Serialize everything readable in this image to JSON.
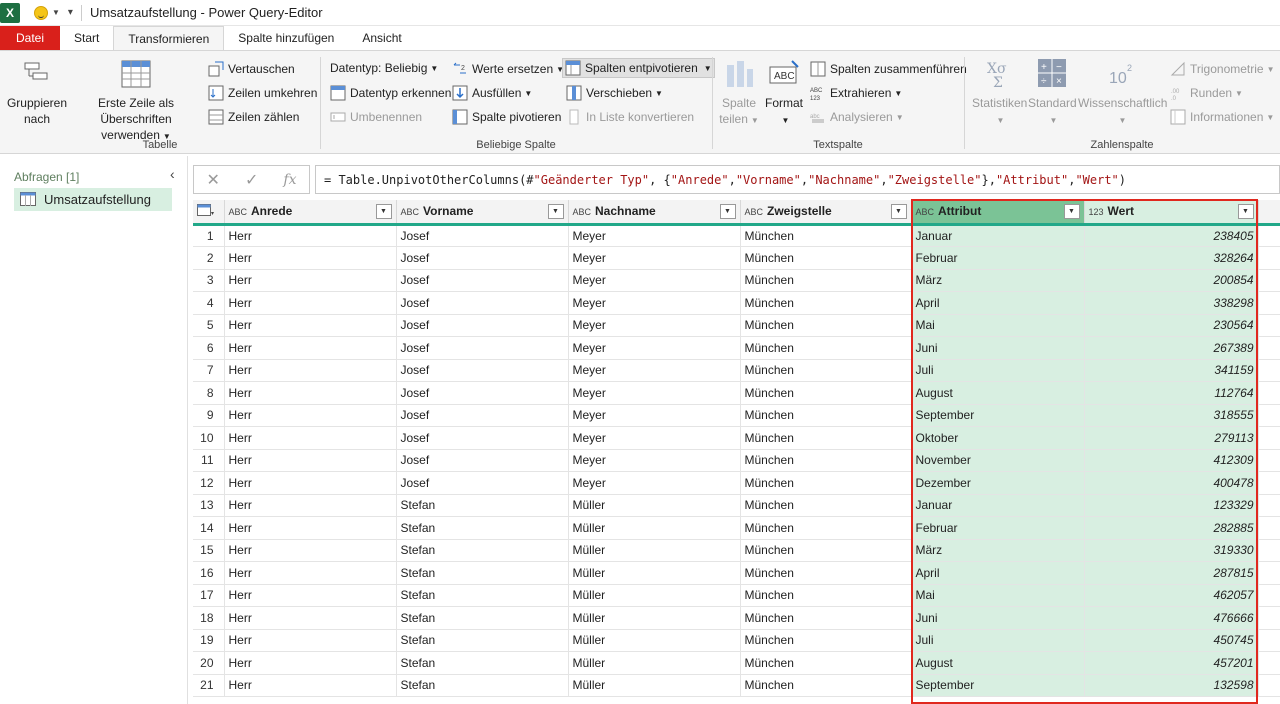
{
  "titlebar": {
    "title": "Umsatzaufstellung - Power Query-Editor",
    "app_logo": "X"
  },
  "tabs": [
    "Datei",
    "Start",
    "Transformieren",
    "Spalte hinzufügen",
    "Ansicht"
  ],
  "ribbon": {
    "tabelle": {
      "label": "Tabelle",
      "gruppieren": "Gruppieren nach",
      "erste_zeile": "Erste Zeile als Überschriften verwenden",
      "vertauschen": "Vertauschen",
      "zeilen_umkehren": "Zeilen umkehren",
      "zeilen_zaehlen": "Zeilen zählen"
    },
    "beliebige_spalte": {
      "label": "Beliebige Spalte",
      "datentyp": "Datentyp: Beliebig",
      "datentyp_erkennen": "Datentyp erkennen",
      "umbenennen": "Umbenennen",
      "werte_ersetzen": "Werte ersetzen",
      "ausfuellen": "Ausfüllen",
      "spalte_pivotieren": "Spalte pivotieren",
      "spalten_entpivotieren": "Spalten entpivotieren",
      "verschieben": "Verschieben",
      "in_liste": "In Liste konvertieren"
    },
    "textspalte": {
      "label": "Textspalte",
      "spalte_teilen": "Spalte teilen",
      "format": "Format",
      "zusammenfuehren": "Spalten zusammenführen",
      "extrahieren": "Extrahieren",
      "analysieren": "Analysieren"
    },
    "zahlenspalte": {
      "label": "Zahlenspalte",
      "statistiken": "Statistiken",
      "standard": "Standard",
      "wissenschaftlich": "Wissenschaftlich",
      "trigonometrie": "Trigonometrie",
      "runden": "Runden",
      "informationen": "Informationen"
    }
  },
  "queries": {
    "header": "Abfragen [1]",
    "items": [
      "Umsatzaufstellung"
    ]
  },
  "formula": {
    "prefix": "= Table.UnpivotOtherColumns(#",
    "s1": "\"Geänderter Typ\"",
    "mid1": ", {",
    "s2": "\"Anrede\"",
    "c1": ", ",
    "s3": "\"Vorname\"",
    "c2": ", ",
    "s4": "\"Nachname\"",
    "c3": ", ",
    "s5": "\"Zweigstelle\"",
    "mid2": "}, ",
    "s6": "\"Attribut\"",
    "c4": ", ",
    "s7": "\"Wert\"",
    "suffix": ")"
  },
  "grid": {
    "columns": [
      {
        "name": "Anrede",
        "type": "ABC"
      },
      {
        "name": "Vorname",
        "type": "ABC"
      },
      {
        "name": "Nachname",
        "type": "ABC"
      },
      {
        "name": "Zweigstelle",
        "type": "ABC"
      },
      {
        "name": "Attribut",
        "type": "ABC"
      },
      {
        "name": "Wert",
        "type": "123"
      }
    ],
    "rows": [
      [
        "Herr",
        "Josef",
        "Meyer",
        "München",
        "Januar",
        "238405"
      ],
      [
        "Herr",
        "Josef",
        "Meyer",
        "München",
        "Februar",
        "328264"
      ],
      [
        "Herr",
        "Josef",
        "Meyer",
        "München",
        "März",
        "200854"
      ],
      [
        "Herr",
        "Josef",
        "Meyer",
        "München",
        "April",
        "338298"
      ],
      [
        "Herr",
        "Josef",
        "Meyer",
        "München",
        "Mai",
        "230564"
      ],
      [
        "Herr",
        "Josef",
        "Meyer",
        "München",
        "Juni",
        "267389"
      ],
      [
        "Herr",
        "Josef",
        "Meyer",
        "München",
        "Juli",
        "341159"
      ],
      [
        "Herr",
        "Josef",
        "Meyer",
        "München",
        "August",
        "112764"
      ],
      [
        "Herr",
        "Josef",
        "Meyer",
        "München",
        "September",
        "318555"
      ],
      [
        "Herr",
        "Josef",
        "Meyer",
        "München",
        "Oktober",
        "279113"
      ],
      [
        "Herr",
        "Josef",
        "Meyer",
        "München",
        "November",
        "412309"
      ],
      [
        "Herr",
        "Josef",
        "Meyer",
        "München",
        "Dezember",
        "400478"
      ],
      [
        "Herr",
        "Stefan",
        "Müller",
        "München",
        "Januar",
        "123329"
      ],
      [
        "Herr",
        "Stefan",
        "Müller",
        "München",
        "Februar",
        "282885"
      ],
      [
        "Herr",
        "Stefan",
        "Müller",
        "München",
        "März",
        "319330"
      ],
      [
        "Herr",
        "Stefan",
        "Müller",
        "München",
        "April",
        "287815"
      ],
      [
        "Herr",
        "Stefan",
        "Müller",
        "München",
        "Mai",
        "462057"
      ],
      [
        "Herr",
        "Stefan",
        "Müller",
        "München",
        "Juni",
        "476666"
      ],
      [
        "Herr",
        "Stefan",
        "Müller",
        "München",
        "Juli",
        "450745"
      ],
      [
        "Herr",
        "Stefan",
        "Müller",
        "München",
        "August",
        "457201"
      ],
      [
        "Herr",
        "Stefan",
        "Müller",
        "München",
        "September",
        "132598"
      ]
    ]
  },
  "colors": {
    "accent_green": "#22a889",
    "selected_col": "#d8efe1",
    "highlight_box": "#e0281e",
    "file_tab": "#d9201b"
  }
}
